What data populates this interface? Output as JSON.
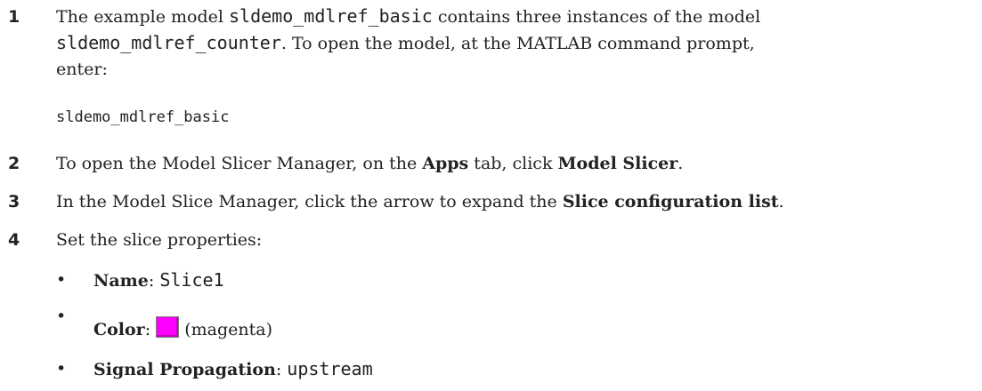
{
  "steps": [
    {
      "number": "1",
      "text1": "The example model ",
      "model_name": "sldemo_mdlref_basic",
      "text2": " contains three instances of the model",
      "counter_name": "sldemo_mdlref_counter",
      "text3": ". To open the model, at the MATLAB command prompt,",
      "text4": "enter:",
      "command": "sldemo_mdlref_basic"
    },
    {
      "number": "2",
      "text1": "To open the Model Slicer Manager, on the ",
      "bold1": "Apps",
      "text2": " tab, click ",
      "bold2": "Model Slicer",
      "text3": "."
    },
    {
      "number": "3",
      "text1": "In the Model Slice Manager, click the arrow to expand the ",
      "bold1": "Slice configuration list",
      "text2": "."
    },
    {
      "number": "4",
      "text1": "Set the slice properties:",
      "bullets": [
        {
          "label": "Name",
          "sep": ": ",
          "value": "Slice1"
        },
        {
          "label": "Color",
          "sep": ": ",
          "value": "(magenta)",
          "swatch_color": "#ff00ff"
        },
        {
          "label": "Signal Propagation",
          "sep": ": ",
          "value": "upstream"
        }
      ]
    }
  ]
}
